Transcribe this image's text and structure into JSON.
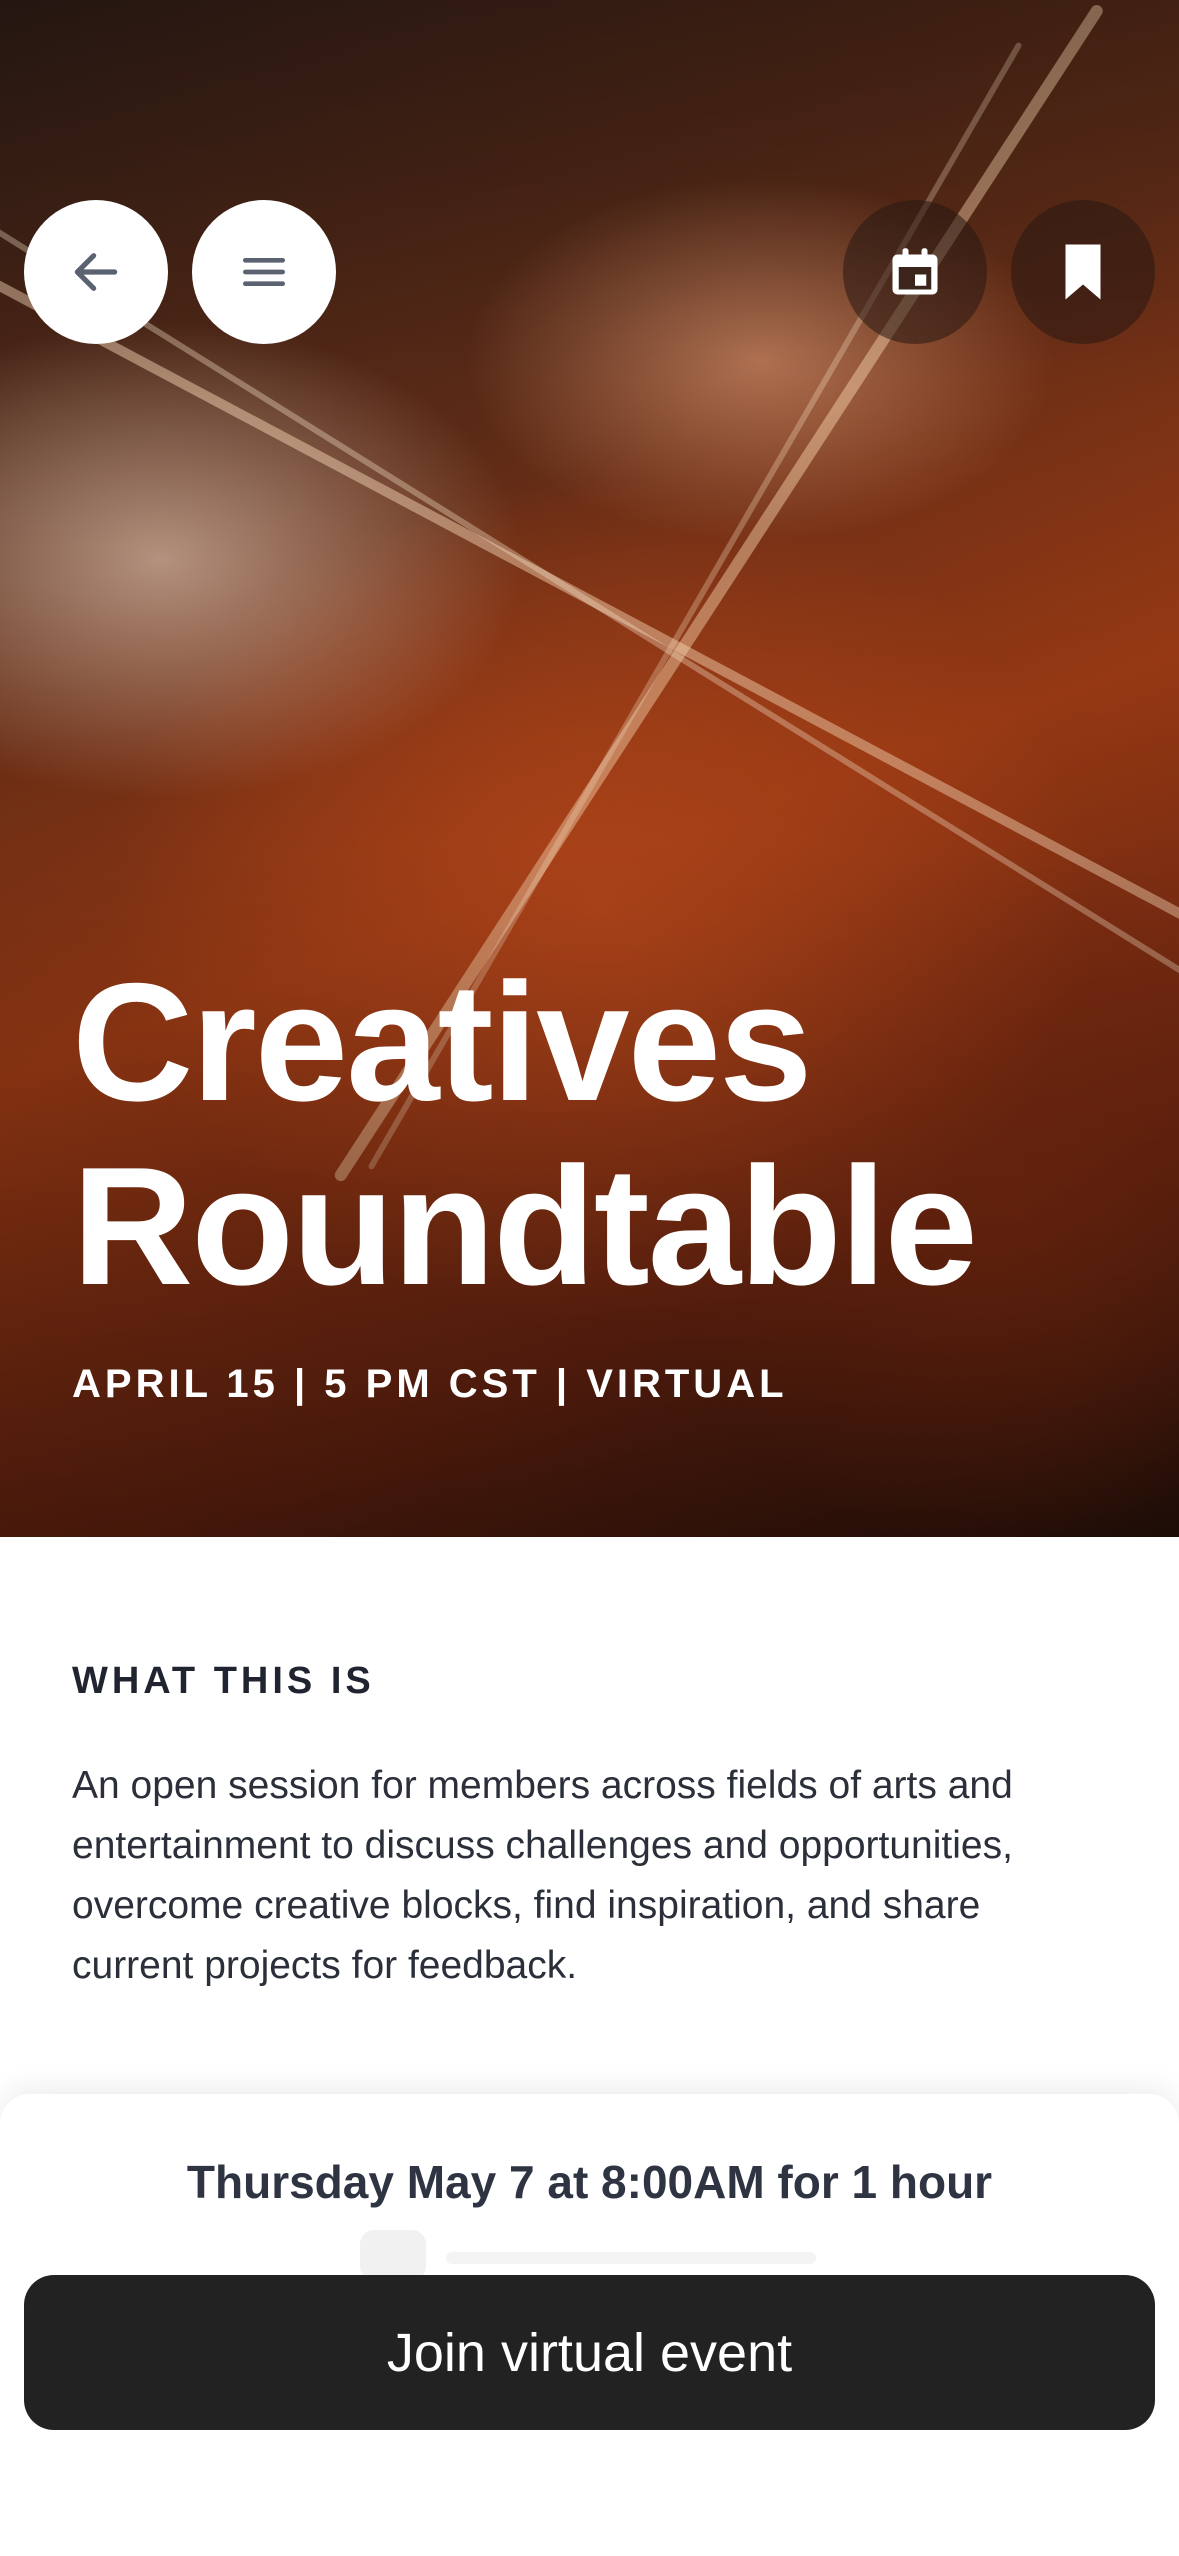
{
  "hero": {
    "title_line1": "Creatives",
    "title_line2": "Roundtable",
    "meta": "APRIL 15 | 5 PM CST | VIRTUAL"
  },
  "toolbar": {
    "back_icon": "arrow-left-icon",
    "menu_icon": "hamburger-menu-icon",
    "calendar_icon": "calendar-icon",
    "bookmark_icon": "bookmark-icon"
  },
  "about": {
    "heading": "WHAT THIS IS",
    "description": "An open session for members across fields of arts and entertainment to discuss challenges and opportunities, overcome creative blocks, find inspiration, and share current projects for feedback."
  },
  "footer": {
    "schedule": "Thursday May 7 at 8:00AM for 1 hour",
    "join_label": "Join virtual event"
  },
  "colors": {
    "button_dark": "#222222",
    "text_dark": "#1f2430",
    "white": "#ffffff"
  }
}
